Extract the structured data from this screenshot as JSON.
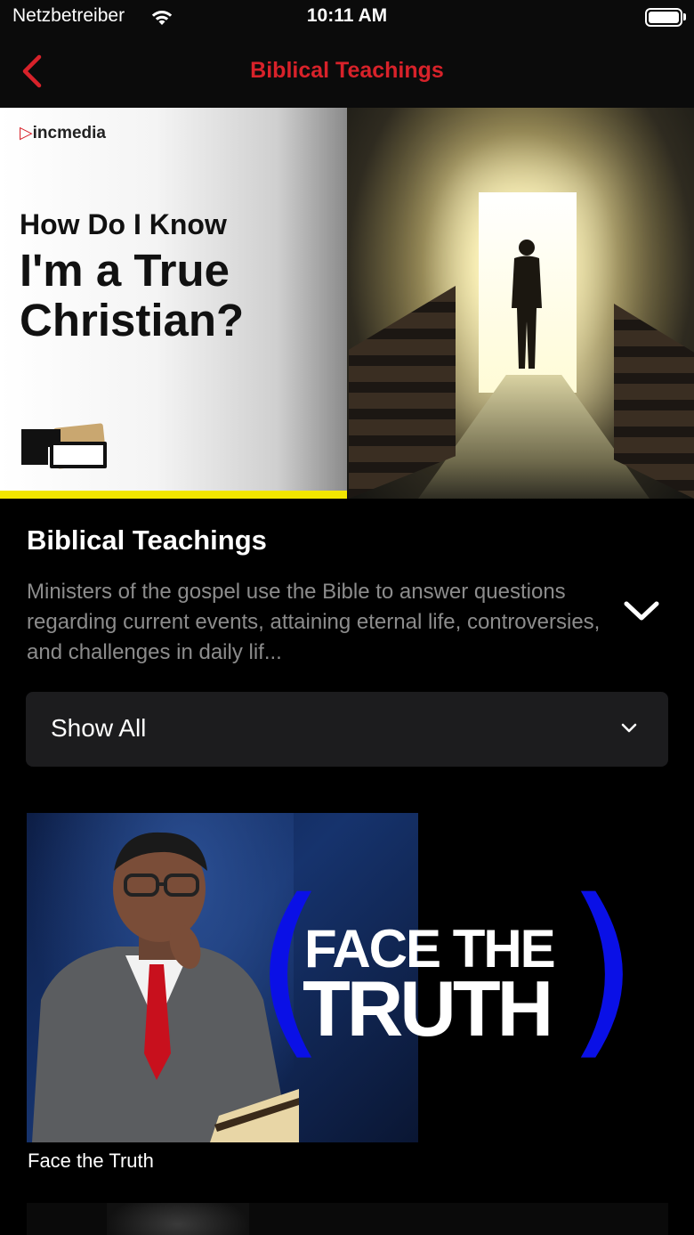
{
  "status_bar": {
    "carrier": "Netzbetreiber",
    "time": "10:11 AM"
  },
  "nav": {
    "title": "Biblical Teachings",
    "accent_color": "#d8222a"
  },
  "hero": {
    "brand": "incmedia",
    "line1": "How Do I Know",
    "line2": "I'm a True",
    "line3": "Christian?",
    "stripe_color": "#f2e600"
  },
  "section": {
    "title": "Biblical Teachings",
    "description": "Ministers of the gospel use the Bible to answer questions regarding current events, attaining eternal life, controversies, and challenges in daily lif..."
  },
  "filter": {
    "selected": "Show All"
  },
  "cards": [
    {
      "title_line1": "FACE THE",
      "title_line2": "TRUTH",
      "caption": "Face the Truth"
    }
  ],
  "icons": {
    "back": "chevron-left-icon",
    "expand": "chevron-down-icon",
    "filter": "chevron-down-icon",
    "wifi": "wifi-icon",
    "battery": "battery-icon"
  }
}
